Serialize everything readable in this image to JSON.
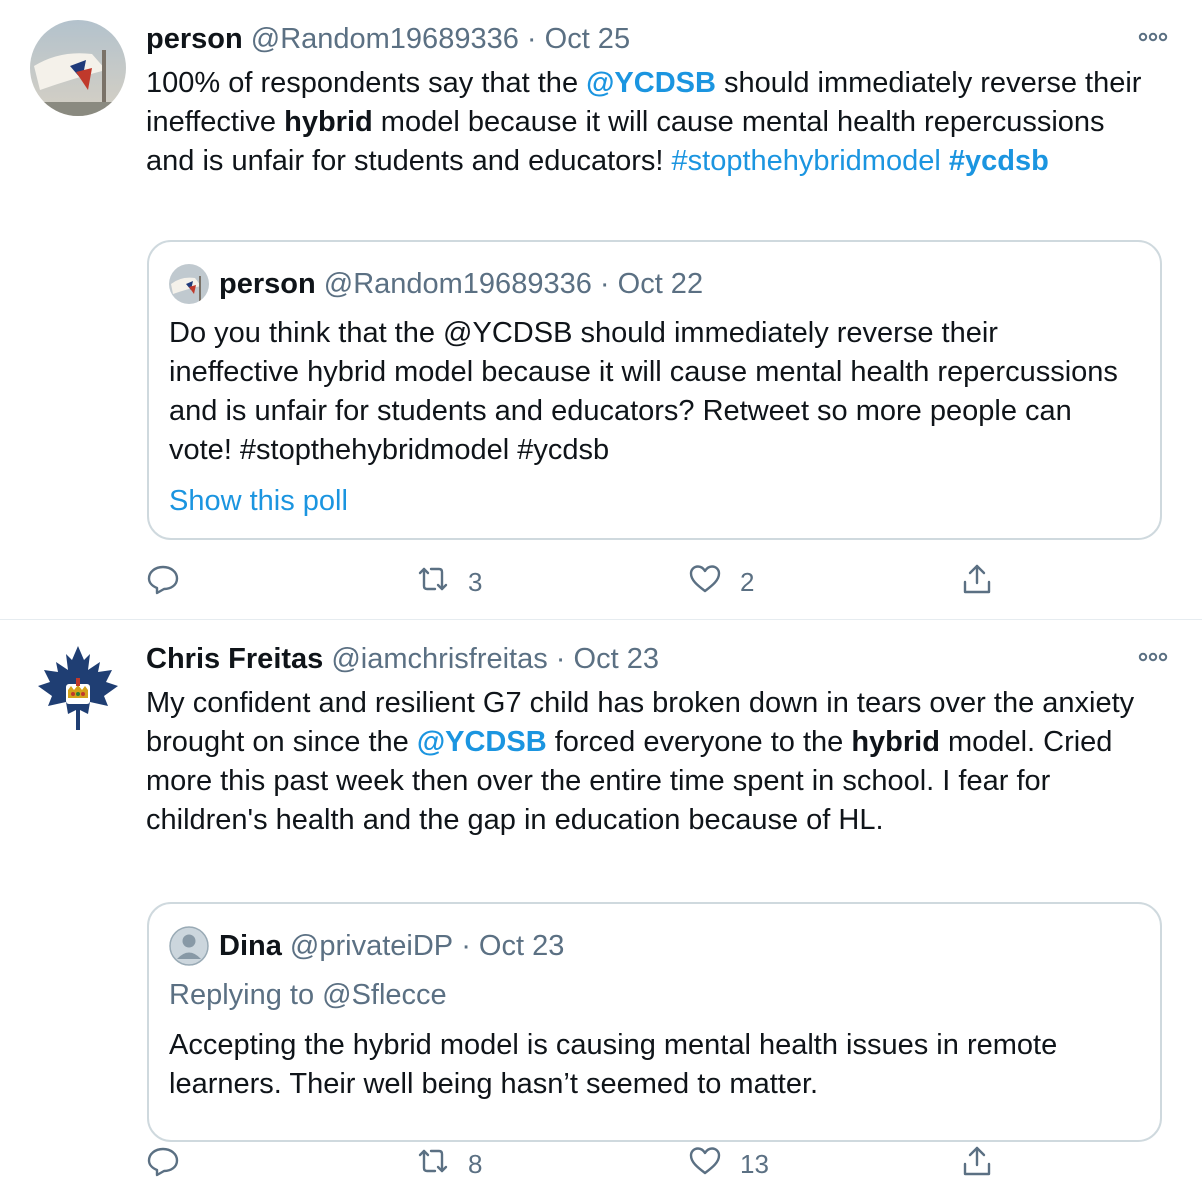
{
  "tweets": [
    {
      "name": "person",
      "handle": "@Random19689336",
      "sep": "·",
      "date": "Oct 25",
      "text": {
        "p1": "100% of respondents say that the ",
        "mention": "@YCDSB",
        "p2": " should immediately reverse their ineffective ",
        "bold": "hybrid",
        "p3": " model because it will cause mental health repercussions and is unfair for students and educators! ",
        "hashtag1": "#stopthehybridmodel",
        "space": " ",
        "hashtag2": "#ycdsb"
      },
      "quote": {
        "name": "person",
        "handle": "@Random19689336",
        "sep": "·",
        "date": "Oct 22",
        "text": "Do you think that the @YCDSB should immediately reverse their ineffective hybrid model because it will cause mental health repercussions and is unfair for students and educators? Retweet so more people can vote! #stopthehybridmodel #ycdsb",
        "link": "Show this poll"
      },
      "actions": {
        "reply": "",
        "retweets": "3",
        "likes": "2"
      }
    },
    {
      "name": "Chris Freitas",
      "handle": "@iamchrisfreitas",
      "sep": "·",
      "date": "Oct 23",
      "text": {
        "p1": "My confident and resilient G7 child has broken down in tears over the anxiety brought on since the ",
        "mention": "@YCDSB",
        "p2": " forced everyone to the ",
        "bold": "hybrid",
        "p3": " model. Cried more this past week then over the entire time spent in school. I fear for children's health and the gap in education because of HL."
      },
      "quote": {
        "name": "Dina",
        "handle": "@privateiDP",
        "sep": "·",
        "date": "Oct 23",
        "replying": "Replying to @Sflecce",
        "text": "Accepting the hybrid model is causing mental health issues in remote learners. Their well being hasn’t seemed to matter."
      },
      "actions": {
        "reply": "",
        "retweets": "8",
        "likes": "13"
      }
    }
  ],
  "colors": {
    "link": "#1b95e0",
    "secondary_text": "#5b7083",
    "border": "#cfd9de",
    "leaf_blue": "#1f3e73"
  },
  "icons": [
    "more-icon",
    "reply-icon",
    "retweet-icon",
    "like-icon",
    "share-icon",
    "default-avatar-icon",
    "maple-leaf-avatar-icon"
  ]
}
